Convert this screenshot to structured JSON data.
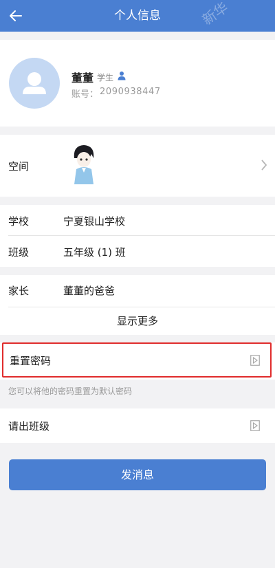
{
  "header": {
    "title": "个人信息",
    "back_icon": "back-arrow-icon"
  },
  "profile": {
    "name": "董董",
    "role": "学生",
    "role_icon": "person-icon",
    "account_label": "账号：",
    "account_value": "2090938447",
    "avatar_icon": "default-avatar-icon"
  },
  "space": {
    "label": "空间",
    "chevron_icon": "chevron-right-icon"
  },
  "info": {
    "school_label": "学校",
    "school_value": "宁夏银山学校",
    "class_label": "班级",
    "class_value": "五年级 (1) 班",
    "parent_label": "家长",
    "parent_value": "董董的爸爸",
    "show_more": "显示更多"
  },
  "actions": {
    "reset_password": "重置密码",
    "reset_hint": "您可以将他的密码重置为默认密码",
    "remove_from_class": "请出班级",
    "action_icon": "play-right-icon",
    "highlight_color": "#e02b2b"
  },
  "send_message": "发消息",
  "theme": {
    "accent": "#4a7fd2",
    "background": "#f2f2f4"
  }
}
